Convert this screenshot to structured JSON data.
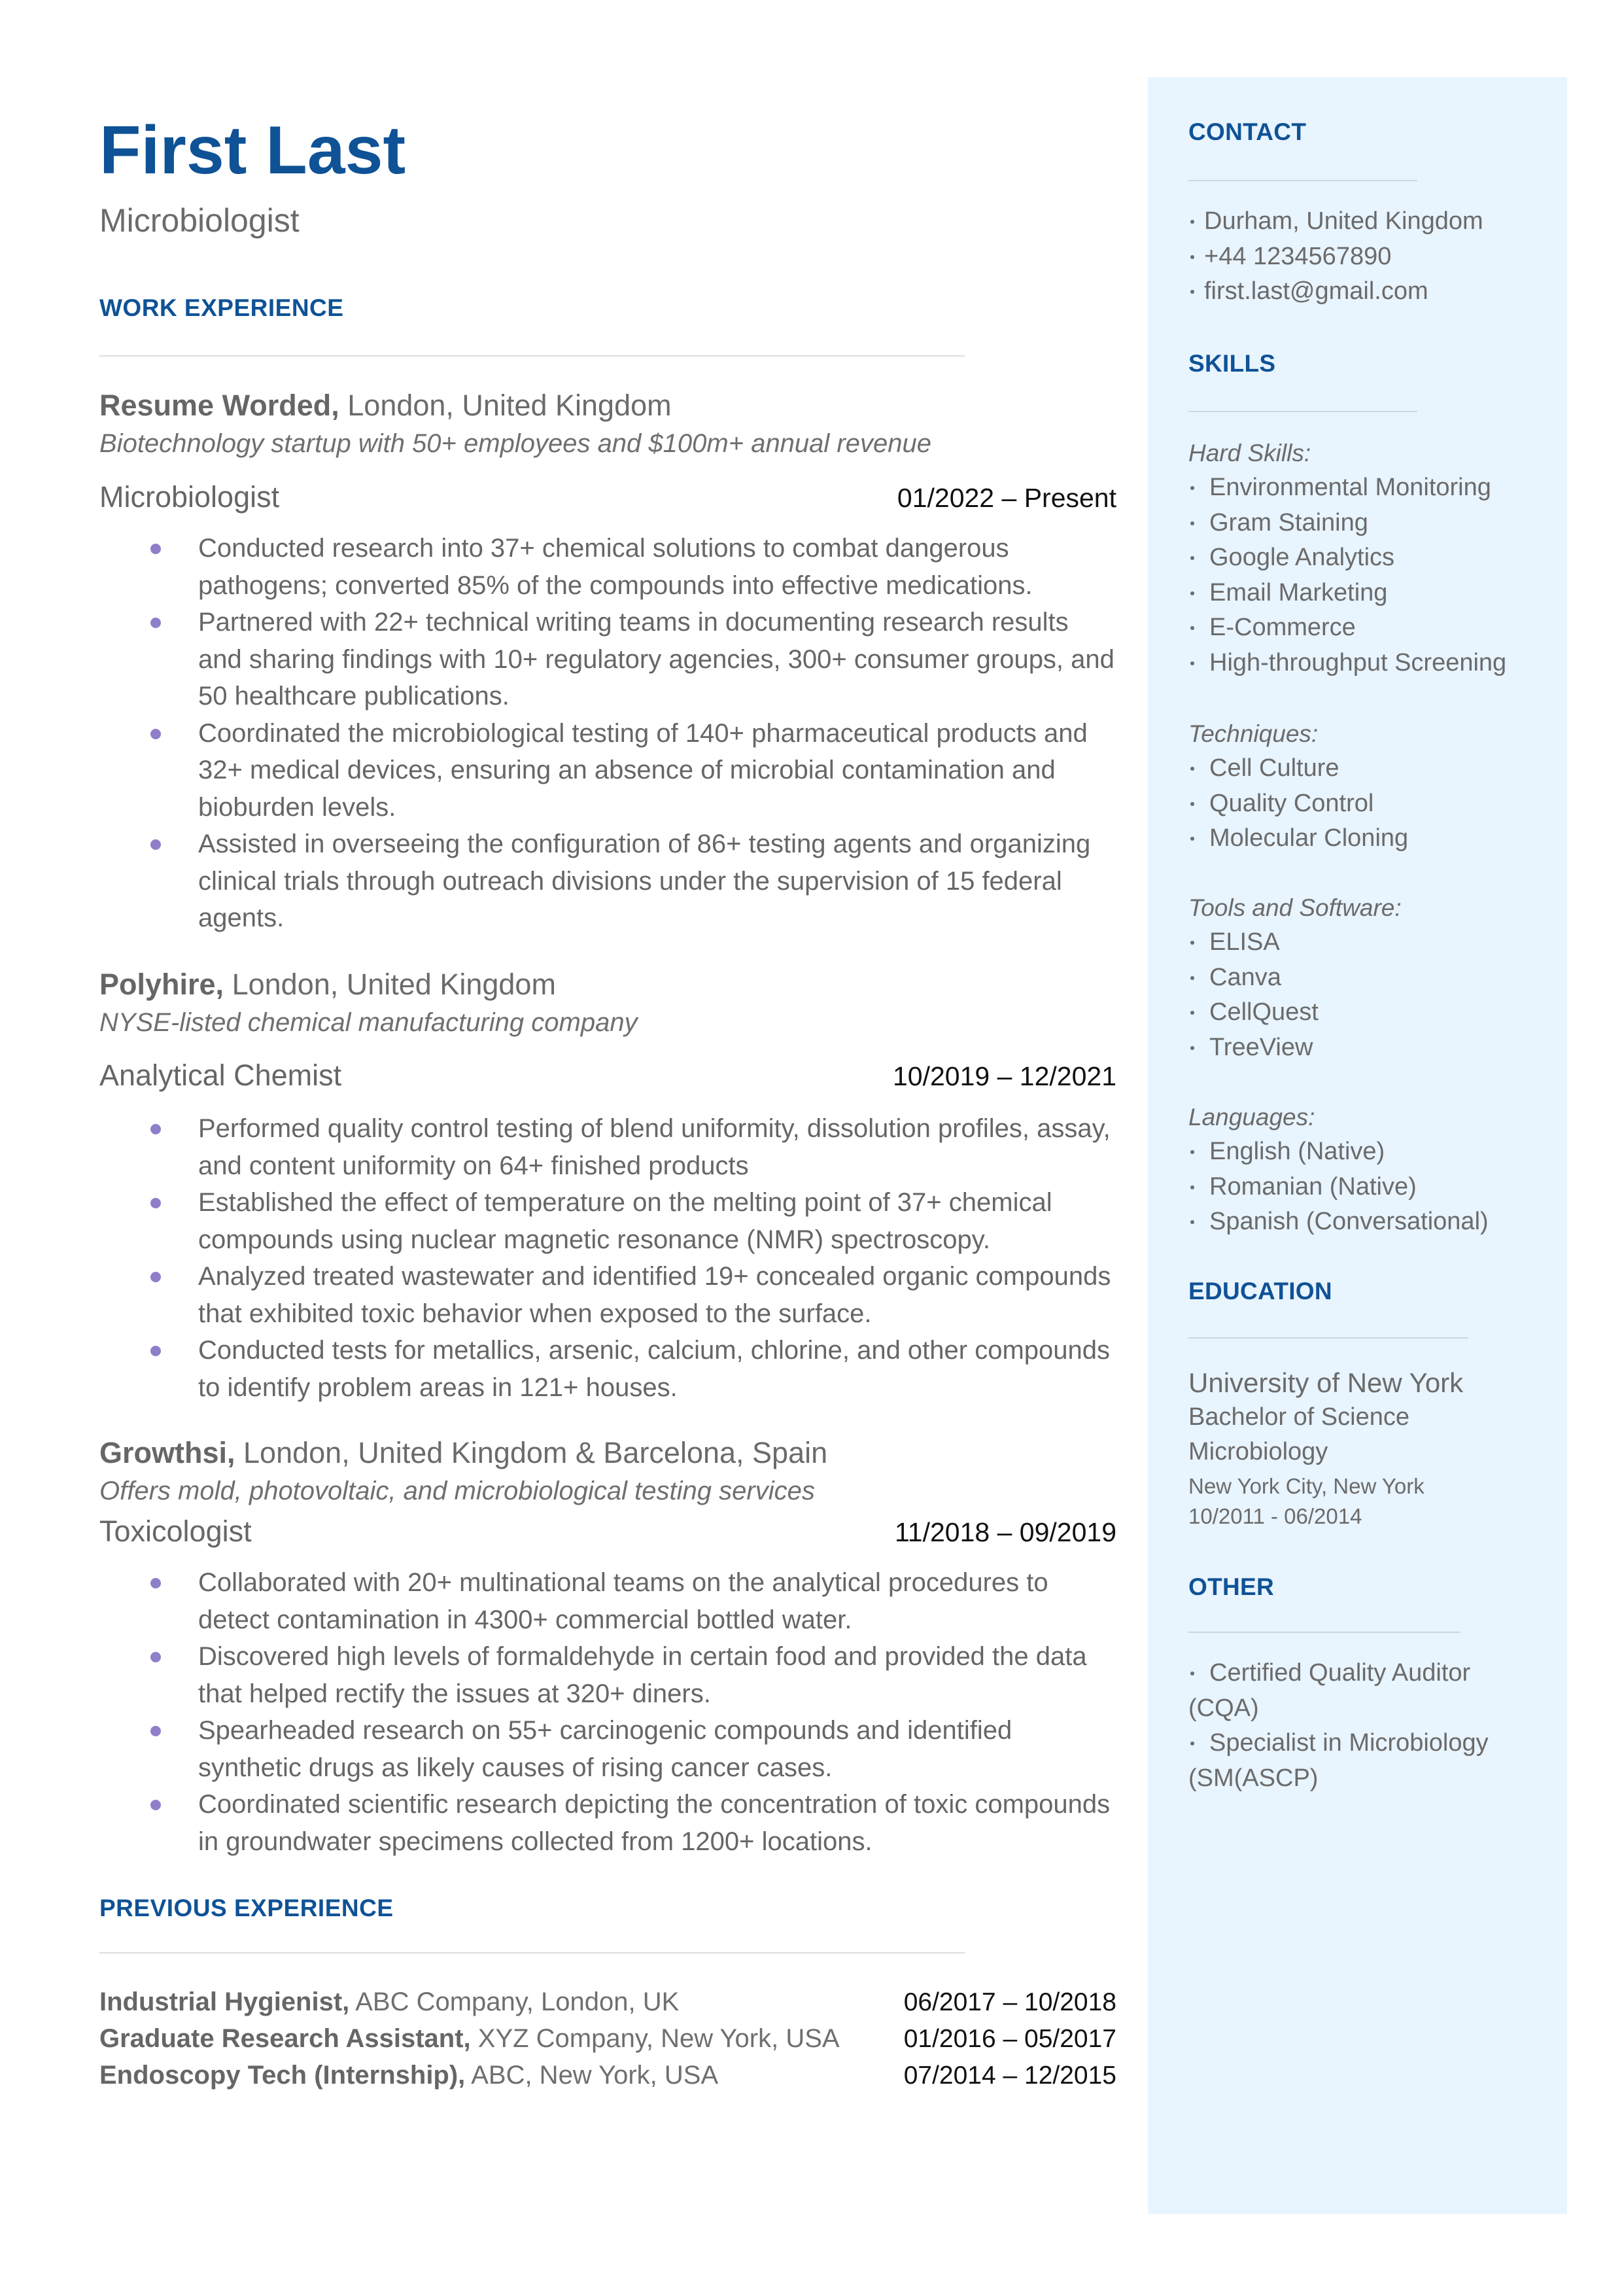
{
  "header": {
    "name": "First Last",
    "title": "Microbiologist"
  },
  "colors": {
    "accent": "#0f5296",
    "sidebar_bg": "#e8f4fe",
    "bullet": "#8f7fc9",
    "text": "#666666",
    "date": "#111111"
  },
  "work_experience": {
    "title": "WORK EXPERIENCE",
    "jobs": [
      {
        "company": "Resume Worded,",
        "location": "London, United Kingdom",
        "description": "Biotechnology startup with 50+ employees and $100m+ annual revenue",
        "role": "Microbiologist",
        "dates": "01/2022 – Present",
        "bullets": [
          "Conducted research into 37+ chemical solutions to combat dangerous pathogens; converted 85% of the compounds into effective medications.",
          "Partnered with 22+ technical writing teams in documenting research results and sharing findings with 10+ regulatory agencies, 300+ consumer groups, and 50 healthcare publications.",
          "Coordinated the microbiological testing of 140+ pharmaceutical products and 32+ medical devices, ensuring an absence of microbial contamination and bioburden levels.",
          "Assisted in overseeing the configuration of 86+ testing agents and organizing clinical trials through outreach divisions under the supervision of 15 federal agents."
        ]
      },
      {
        "company": "Polyhire,",
        "location": "London, United Kingdom",
        "description": "NYSE-listed chemical manufacturing company",
        "role": "Analytical Chemist",
        "dates": "10/2019 – 12/2021",
        "bullets": [
          "Performed quality control testing of blend uniformity, dissolution profiles, assay, and content uniformity on 64+ finished products",
          "Established the effect of temperature on the melting point of 37+ chemical compounds using nuclear magnetic resonance (NMR) spectroscopy.",
          "Analyzed treated wastewater and identified 19+ concealed organic compounds that exhibited toxic behavior when exposed to the surface.",
          "Conducted tests for metallics, arsenic, calcium, chlorine, and other compounds to identify problem areas in 121+ houses."
        ]
      },
      {
        "company": "Growthsi,",
        "location": "London, United Kingdom & Barcelona, Spain",
        "description": "Offers mold, photovoltaic, and microbiological testing services",
        "role": "Toxicologist",
        "dates": "11/2018 – 09/2019",
        "bullets": [
          "Collaborated with 20+ multinational teams on the analytical procedures to detect contamination in 4300+ commercial bottled water.",
          "Discovered high levels of formaldehyde in certain food and provided the data that helped rectify the issues at 320+ diners.",
          "Spearheaded research on 55+ carcinogenic compounds and identified synthetic drugs as likely causes of rising cancer cases.",
          "Coordinated scientific research depicting the concentration of toxic compounds in groundwater specimens collected from 1200+ locations."
        ]
      }
    ]
  },
  "previous_experience": {
    "title": "PREVIOUS EXPERIENCE",
    "items": [
      {
        "role": "Industrial Hygienist,",
        "location": "ABC Company, London, UK",
        "dates": "06/2017 – 10/2018"
      },
      {
        "role": "Graduate Research Assistant,",
        "location": "XYZ Company, New York, USA",
        "dates": "01/2016 – 05/2017"
      },
      {
        "role": "Endoscopy Tech (Internship),",
        "location": "ABC, New York, USA",
        "dates": "07/2014 – 12/2015"
      }
    ]
  },
  "sidebar": {
    "contact": {
      "title": "CONTACT",
      "items": [
        "Durham, United Kingdom",
        "+44 1234567890",
        "first.last@gmail.com"
      ]
    },
    "skills": {
      "title": "SKILLS",
      "groups": [
        {
          "label": "Hard Skills:",
          "items": [
            "Environmental Monitoring",
            "Gram Staining",
            "Google Analytics",
            "Email Marketing",
            "E-Commerce",
            "High-throughput Screening"
          ]
        },
        {
          "label": "Techniques:",
          "items": [
            "Cell Culture",
            "Quality Control",
            "Molecular Cloning"
          ]
        },
        {
          "label": "Tools and Software:",
          "items": [
            "ELISA",
            "Canva",
            "CellQuest",
            "TreeView"
          ]
        },
        {
          "label": "Languages:",
          "items": [
            "English (Native)",
            "Romanian (Native)",
            "Spanish (Conversational)"
          ]
        }
      ]
    },
    "education": {
      "title": "EDUCATION",
      "school": "University of New York",
      "degree": "Bachelor of Science",
      "field": "Microbiology",
      "location": "New York City, New York",
      "dates": "10/2011 - 06/2014"
    },
    "other": {
      "title": "OTHER",
      "items": [
        "Certified Quality Auditor (CQA)",
        "Specialist in Microbiology (SM(ASCP)"
      ]
    }
  }
}
